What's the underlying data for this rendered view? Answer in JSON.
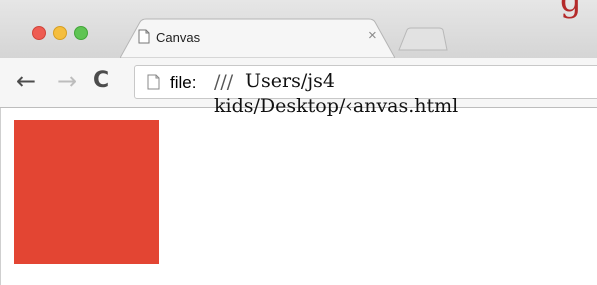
{
  "browser": {
    "tab": {
      "title": "Canvas",
      "close_icon": "close-icon"
    },
    "brand_glyph": "g",
    "toolbar": {
      "back_icon": "arrow-left-icon",
      "forward_icon": "arrow-right-icon",
      "reload_icon": "reload-icon"
    },
    "address_bar": {
      "scheme": "file:",
      "separator": "///",
      "path_line1": "Users/js4",
      "path_line2": "kids/Desktop/‹anvas.html"
    }
  },
  "page": {
    "canvas_fill_color": "#e34533"
  }
}
